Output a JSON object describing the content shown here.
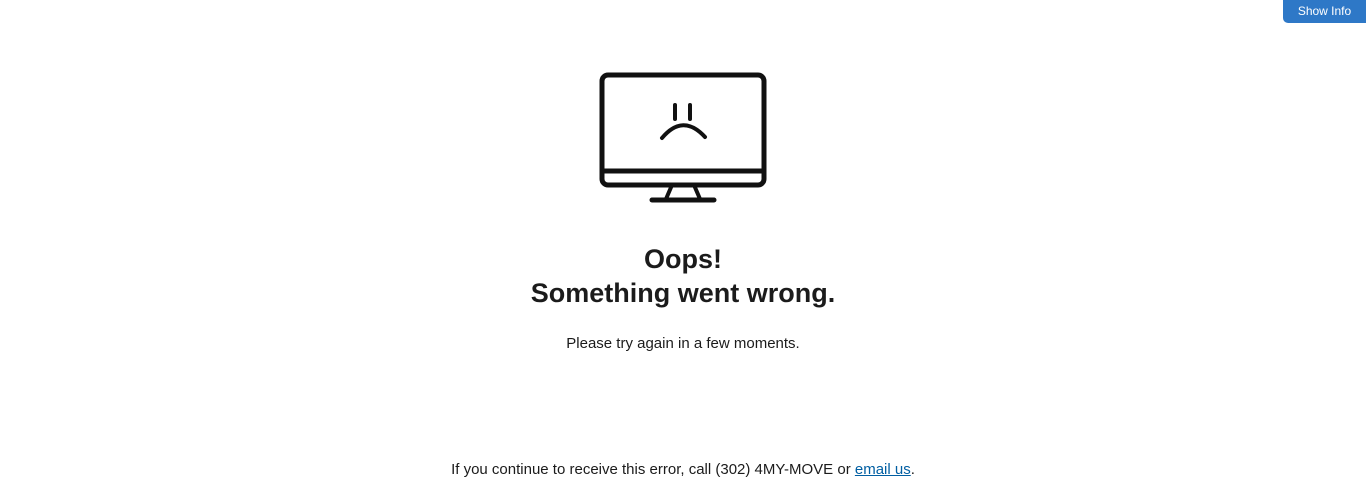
{
  "header": {
    "show_info_label": "Show Info"
  },
  "error": {
    "icon": "sad-monitor-icon",
    "title_line1": "Oops!",
    "title_line2": "Something went wrong.",
    "message": "Please try again in a few moments."
  },
  "footer": {
    "prefix": "If you continue to receive this error, call (302) 4MY-MOVE or ",
    "link_label": "email us",
    "suffix": "."
  },
  "colors": {
    "button_bg": "#2e78c7",
    "link": "#005ea2",
    "text": "#1b1b1b"
  }
}
